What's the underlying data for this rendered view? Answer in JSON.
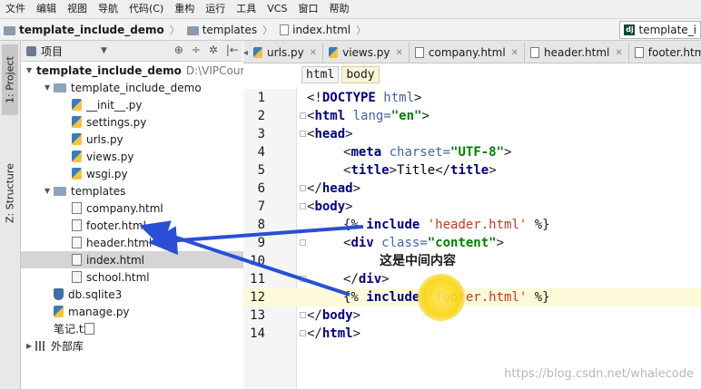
{
  "menu": [
    "文件",
    "编辑",
    "视图",
    "导航",
    "代码(C)",
    "重构",
    "运行",
    "工具",
    "VCS",
    "窗口",
    "帮助"
  ],
  "nav": {
    "project": "template_include_demo",
    "folder": "templates",
    "file": "index.html",
    "right_tab": "template_i"
  },
  "side_tabs": {
    "project": "1: Project",
    "structure": "Z: Structure"
  },
  "project_panel": {
    "title": "项目",
    "icons": [
      "⊕",
      "÷",
      "✲",
      "|←"
    ]
  },
  "tree": [
    {
      "label": "template_include_demo",
      "extra": "D:\\VIPCourse",
      "type": "folder",
      "level": 0,
      "expanded": true,
      "bold": true
    },
    {
      "label": "template_include_demo",
      "type": "folder",
      "level": 1,
      "expanded": true
    },
    {
      "label": "__init__.py",
      "type": "py",
      "level": 2
    },
    {
      "label": "settings.py",
      "type": "py",
      "level": 2
    },
    {
      "label": "urls.py",
      "type": "py",
      "level": 2
    },
    {
      "label": "views.py",
      "type": "py",
      "level": 2
    },
    {
      "label": "wsgi.py",
      "type": "py",
      "level": 2
    },
    {
      "label": "templates",
      "type": "folder",
      "level": 1,
      "expanded": true
    },
    {
      "label": "company.html",
      "type": "html",
      "level": 2
    },
    {
      "label": "footer.html",
      "type": "html",
      "level": 2
    },
    {
      "label": "header.html",
      "type": "html",
      "level": 2
    },
    {
      "label": "index.html",
      "type": "html",
      "level": 2,
      "selected": true
    },
    {
      "label": "school.html",
      "type": "html",
      "level": 2
    },
    {
      "label": "db.sqlite3",
      "type": "db",
      "level": 1
    },
    {
      "label": "manage.py",
      "type": "py",
      "level": 1
    },
    {
      "label": "笔记.txt",
      "type": "txt",
      "level": 1
    },
    {
      "label": "外部库",
      "type": "lib",
      "level": 0,
      "expanded": false
    }
  ],
  "editor_tabs": [
    {
      "label": "urls.py",
      "type": "py"
    },
    {
      "label": "views.py",
      "type": "py"
    },
    {
      "label": "company.html",
      "type": "html"
    },
    {
      "label": "header.html",
      "type": "html"
    },
    {
      "label": "footer.html",
      "type": "html"
    }
  ],
  "tag_crumbs": [
    "html",
    "body"
  ],
  "code_lines": [
    {
      "n": "1",
      "ind": 0,
      "parts": [
        [
          "p",
          "<!"
        ],
        [
          "t",
          "DOCTYPE "
        ],
        [
          "a",
          "html"
        ],
        [
          "p",
          ">"
        ]
      ]
    },
    {
      "n": "2",
      "ind": 0,
      "parts": [
        [
          "p",
          "<"
        ],
        [
          "t",
          "html "
        ],
        [
          "a",
          "lang="
        ],
        [
          "s",
          "\"en\""
        ],
        [
          "p",
          ">"
        ]
      ]
    },
    {
      "n": "3",
      "ind": 0,
      "parts": [
        [
          "p",
          "<"
        ],
        [
          "t",
          "head"
        ],
        [
          "p",
          ">"
        ]
      ]
    },
    {
      "n": "4",
      "ind": 1,
      "parts": [
        [
          "p",
          "<"
        ],
        [
          "t",
          "meta "
        ],
        [
          "a",
          "charset="
        ],
        [
          "s",
          "\"UTF-8\""
        ],
        [
          "p",
          ">"
        ]
      ]
    },
    {
      "n": "5",
      "ind": 1,
      "parts": [
        [
          "p",
          "<"
        ],
        [
          "t",
          "title"
        ],
        [
          "p",
          ">"
        ],
        [
          "txtc",
          "Title"
        ],
        [
          "p",
          "</"
        ],
        [
          "t",
          "title"
        ],
        [
          "p",
          ">"
        ]
      ]
    },
    {
      "n": "6",
      "ind": 0,
      "parts": [
        [
          "p",
          "</"
        ],
        [
          "t",
          "head"
        ],
        [
          "p",
          ">"
        ]
      ]
    },
    {
      "n": "7",
      "ind": 0,
      "parts": [
        [
          "p",
          "<"
        ],
        [
          "t",
          "body"
        ],
        [
          "p",
          ">"
        ]
      ]
    },
    {
      "n": "8",
      "ind": 1,
      "parts": [
        [
          "p",
          "{% "
        ],
        [
          "kw",
          "include "
        ],
        [
          "str",
          "'header.html'"
        ],
        [
          "p",
          " %}"
        ]
      ]
    },
    {
      "n": "9",
      "ind": 1,
      "parts": [
        [
          "p",
          "<"
        ],
        [
          "t",
          "div "
        ],
        [
          "a",
          "class="
        ],
        [
          "s",
          "\"content\""
        ],
        [
          "p",
          ">"
        ]
      ]
    },
    {
      "n": "10",
      "ind": 2,
      "parts": [
        [
          "cjk",
          "这是中间内容"
        ]
      ]
    },
    {
      "n": "11",
      "ind": 1,
      "parts": [
        [
          "p",
          "</"
        ],
        [
          "t",
          "div"
        ],
        [
          "p",
          ">"
        ]
      ]
    },
    {
      "n": "12",
      "ind": 1,
      "hl": true,
      "parts": [
        [
          "p",
          "{% "
        ],
        [
          "kw",
          "include "
        ],
        [
          "str",
          "'footer.html'"
        ],
        [
          "p",
          " %}"
        ]
      ]
    },
    {
      "n": "13",
      "ind": 0,
      "parts": [
        [
          "p",
          "</"
        ],
        [
          "t",
          "body"
        ],
        [
          "p",
          ">"
        ]
      ]
    },
    {
      "n": "14",
      "ind": 0,
      "parts": [
        [
          "p",
          "</"
        ],
        [
          "t",
          "html"
        ],
        [
          "p",
          ">"
        ]
      ]
    }
  ],
  "colors": {
    "arrow": "#2a4fd6",
    "highlight_line": "#fcfad9",
    "cursor_spot": "#f8d40a"
  },
  "watermark": "https://blog.csdn.net/whalecode"
}
